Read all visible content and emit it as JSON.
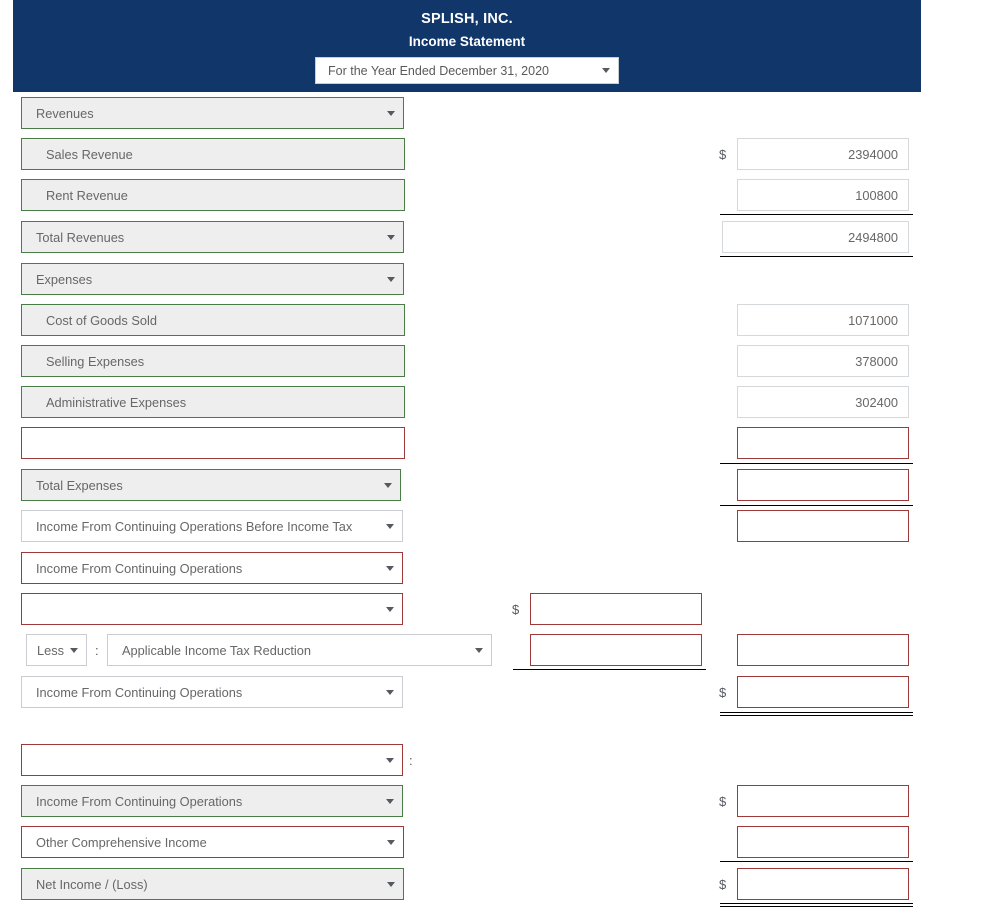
{
  "header": {
    "company": "SPLISH, INC.",
    "statement_title": "Income Statement",
    "period": "For the Year Ended December 31, 2020",
    "banner_color": "#10366a"
  },
  "colors": {
    "valid_border": "#4a7d46",
    "invalid_border": "#9e3a3a",
    "neutral_border": "#c9ccd0",
    "filled_background": "#eeeeee"
  },
  "symbols": {
    "dollar": "$",
    "colon": ":"
  },
  "rows": [
    {
      "label": "Revenues",
      "state": "ok",
      "kind": "select",
      "value": "",
      "value_state": "none",
      "dollar": false
    },
    {
      "label": "Sales Revenue",
      "state": "ok",
      "kind": "text",
      "value": "2394000",
      "value_state": "filled",
      "dollar": true
    },
    {
      "label": "Rent Revenue",
      "state": "ok",
      "kind": "text",
      "value": "100800",
      "value_state": "filled",
      "dollar": false
    },
    {
      "label": "Total Revenues",
      "state": "ok",
      "kind": "select",
      "value": "2494800",
      "value_state": "filled",
      "dollar": false
    },
    {
      "label": "Expenses",
      "state": "ok",
      "kind": "select",
      "value": "",
      "value_state": "none",
      "dollar": false
    },
    {
      "label": "Cost of Goods Sold",
      "state": "ok",
      "kind": "text",
      "value": "1071000",
      "value_state": "filled",
      "dollar": false
    },
    {
      "label": "Selling Expenses",
      "state": "ok",
      "kind": "text",
      "value": "378000",
      "value_state": "filled",
      "dollar": false
    },
    {
      "label": "Administrative Expenses",
      "state": "ok",
      "kind": "text",
      "value": "302400",
      "value_state": "filled",
      "dollar": false
    },
    {
      "label": "",
      "state": "err",
      "kind": "text",
      "value": "",
      "value_state": "empty",
      "dollar": false
    },
    {
      "label": "Total Expenses",
      "state": "ok",
      "kind": "select",
      "value": "",
      "value_state": "empty",
      "dollar": false
    },
    {
      "label": "Income From Continuing Operations Before Income Tax",
      "state": "plain",
      "kind": "select",
      "value": "",
      "value_state": "empty",
      "dollar": false
    },
    {
      "label": "Income From Continuing Operations",
      "state": "err",
      "kind": "select",
      "value": "",
      "value_state": "none",
      "dollar": false
    },
    {
      "label": "",
      "state": "err",
      "kind": "select",
      "value": "",
      "value_state": "none",
      "dollar": false
    },
    {
      "label": "Applicable Income Tax Reduction",
      "state": "plain",
      "kind": "select",
      "value": "",
      "value_state": "empty",
      "dollar": false,
      "prefix": "Less"
    },
    {
      "label": "Income From Continuing Operations",
      "state": "plain",
      "kind": "select",
      "value": "",
      "value_state": "empty",
      "dollar": true
    },
    {
      "label": "",
      "state": "err",
      "kind": "select",
      "value": "",
      "value_state": "none",
      "dollar": false,
      "suffix_colon": true
    },
    {
      "label": "Income From Continuing Operations",
      "state": "ok",
      "kind": "select",
      "value": "",
      "value_state": "empty",
      "dollar": true
    },
    {
      "label": "Other Comprehensive Income",
      "state": "err",
      "kind": "select",
      "value": "",
      "value_state": "empty",
      "dollar": false
    },
    {
      "label": "Net Income / (Loss)",
      "state": "ok",
      "kind": "select",
      "value": "",
      "value_state": "empty",
      "dollar": true
    }
  ],
  "mid_inputs": [
    {
      "name": "pretax-amount",
      "value": "",
      "dollar": true
    },
    {
      "name": "tax-reduction-amount",
      "value": "",
      "dollar": false
    }
  ],
  "row_labels": {
    "less_option": "Less"
  }
}
